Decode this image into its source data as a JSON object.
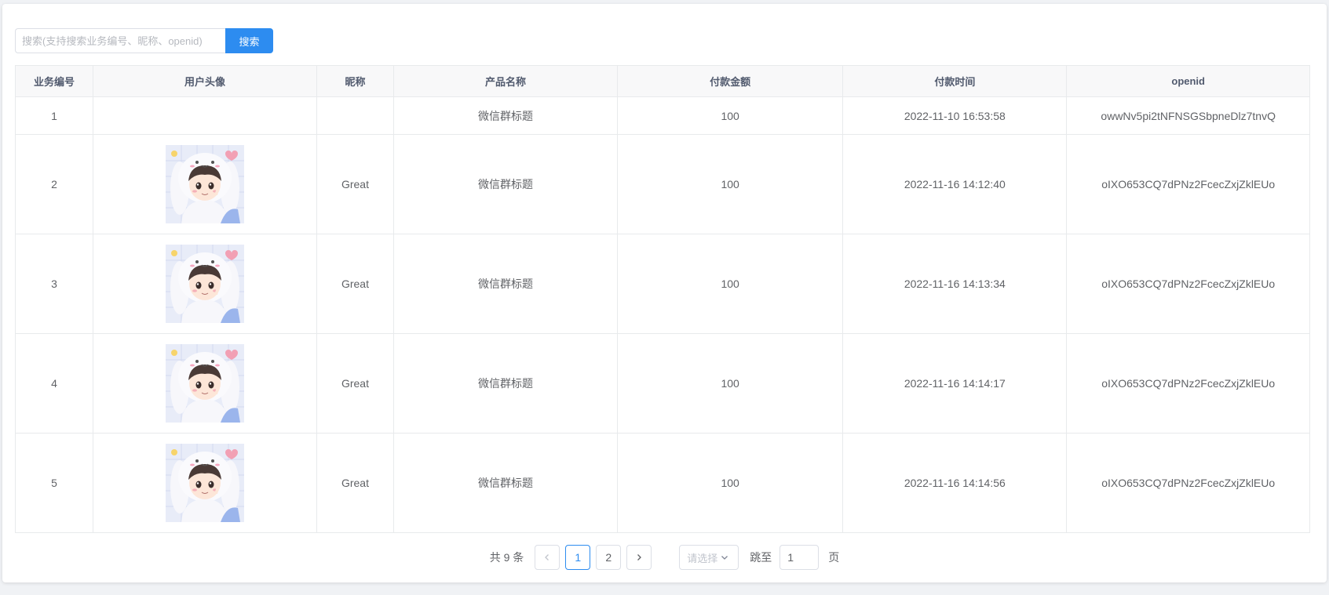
{
  "search": {
    "placeholder": "搜索(支持搜索业务编号、昵称、openid)",
    "value": "",
    "button_label": "搜索"
  },
  "table": {
    "headers": [
      "业务编号",
      "用户头像",
      "昵称",
      "产品名称",
      "付款金额",
      "付款时间",
      "openid"
    ],
    "rows": [
      {
        "id": "1",
        "has_avatar": false,
        "nickname": "",
        "product": "微信群标题",
        "amount": "100",
        "paid_at": "2022-11-10 16:53:58",
        "openid": "owwNv5pi2tNFNSGSbpneDlz7tnvQ"
      },
      {
        "id": "2",
        "has_avatar": true,
        "nickname": "Great",
        "product": "微信群标题",
        "amount": "100",
        "paid_at": "2022-11-16 14:12:40",
        "openid": "oIXO653CQ7dPNz2FcecZxjZklEUo"
      },
      {
        "id": "3",
        "has_avatar": true,
        "nickname": "Great",
        "product": "微信群标题",
        "amount": "100",
        "paid_at": "2022-11-16 14:13:34",
        "openid": "oIXO653CQ7dPNz2FcecZxjZklEUo"
      },
      {
        "id": "4",
        "has_avatar": true,
        "nickname": "Great",
        "product": "微信群标题",
        "amount": "100",
        "paid_at": "2022-11-16 14:14:17",
        "openid": "oIXO653CQ7dPNz2FcecZxjZklEUo"
      },
      {
        "id": "5",
        "has_avatar": true,
        "nickname": "Great",
        "product": "微信群标题",
        "amount": "100",
        "paid_at": "2022-11-16 14:14:56",
        "openid": "oIXO653CQ7dPNz2FcecZxjZklEUo"
      }
    ]
  },
  "pagination": {
    "total_text": "共 9 条",
    "prev_icon": "chevron-left-icon",
    "pages": [
      "1",
      "2"
    ],
    "current_page": "1",
    "next_icon": "chevron-right-icon",
    "page_size_placeholder": "请选择",
    "jump_label": "跳至",
    "jump_value": "1",
    "page_suffix": "页"
  },
  "colors": {
    "accent": "#2d8cf0",
    "header_bg": "#f8f8f9",
    "border": "#e8eaec"
  }
}
